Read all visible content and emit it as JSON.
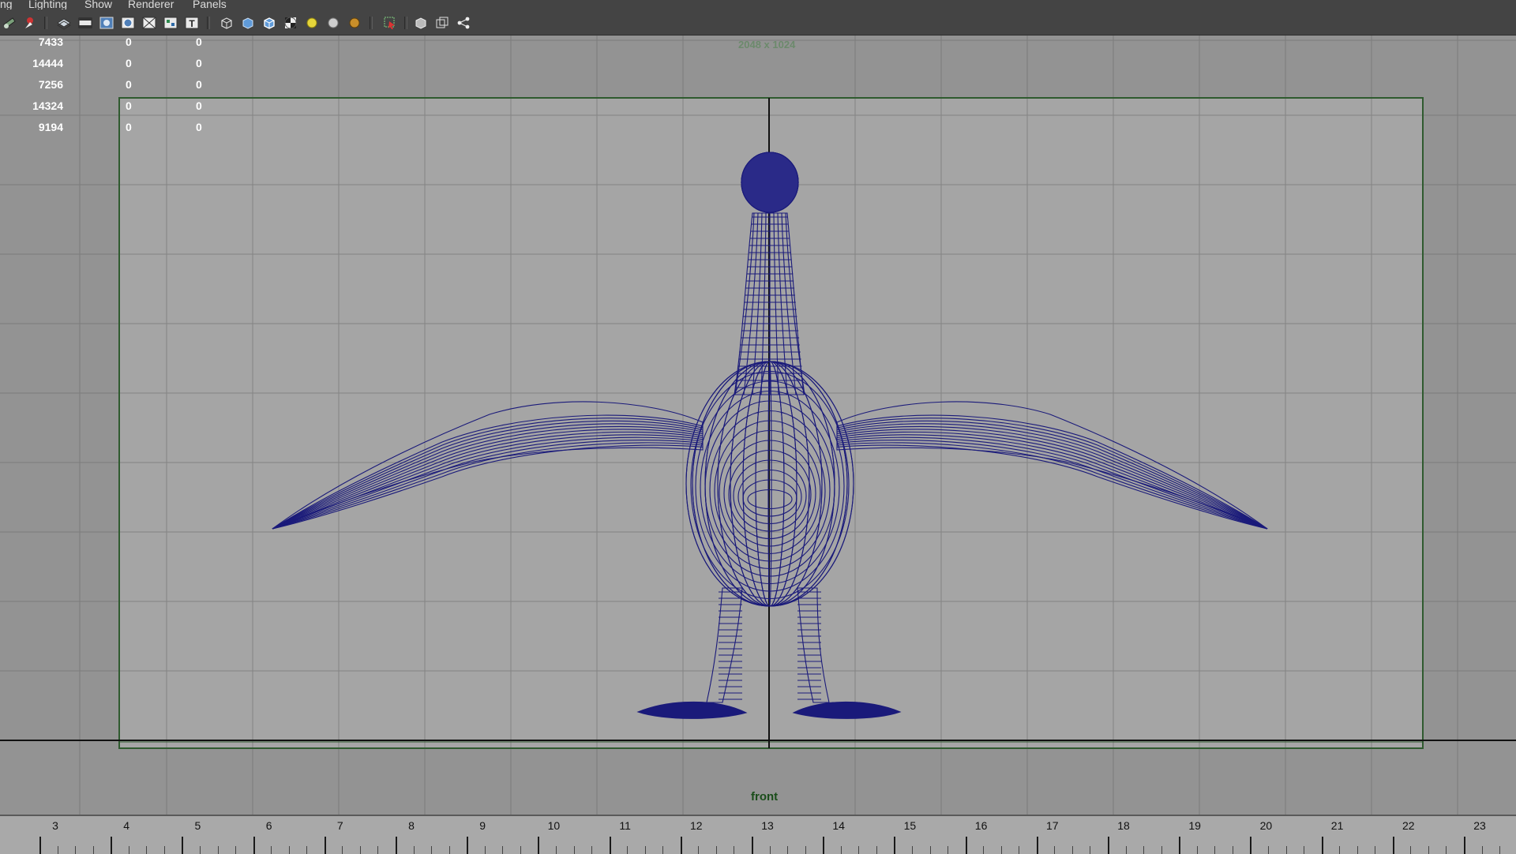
{
  "menu": {
    "items": [
      "ng",
      "Lighting",
      "Show",
      "Renderer",
      "Panels"
    ]
  },
  "toolbar": {
    "icons": [
      "camera-select-icon",
      "camera-attributes-icon",
      "image-plane-icon",
      "film-gate-icon",
      "resolution-gate-icon",
      "gate-mask-icon",
      "field-chart-icon",
      "safe-action-icon",
      "safe-title-icon",
      "wireframe-cube-icon",
      "smooth-shade-icon",
      "wireframe-on-shaded-icon",
      "textured-icon",
      "use-all-lights-icon",
      "shadows-icon",
      "screen-space-ao-icon",
      "isolate-select-icon",
      "xray-icon",
      "xray-joints-icon",
      "xray-components-icon"
    ]
  },
  "hud": {
    "rows": [
      {
        "a": "7433",
        "b": "0",
        "c": "0"
      },
      {
        "a": "14444",
        "b": "0",
        "c": "0"
      },
      {
        "a": "7256",
        "b": "0",
        "c": "0"
      },
      {
        "a": "14324",
        "b": "0",
        "c": "0"
      },
      {
        "a": "9194",
        "b": "0",
        "c": "0"
      }
    ]
  },
  "viewport": {
    "resolution": "2048 x 1024",
    "camera": "front",
    "wire_color": "#1a1a7a",
    "gate_color": "#2f5a2f",
    "background": "#939393"
  },
  "timeline": {
    "ticks": [
      "3",
      "4",
      "5",
      "6",
      "7",
      "8",
      "9",
      "10",
      "11",
      "12",
      "13",
      "14",
      "15",
      "16",
      "17",
      "18",
      "19",
      "20",
      "21",
      "22",
      "23"
    ]
  }
}
